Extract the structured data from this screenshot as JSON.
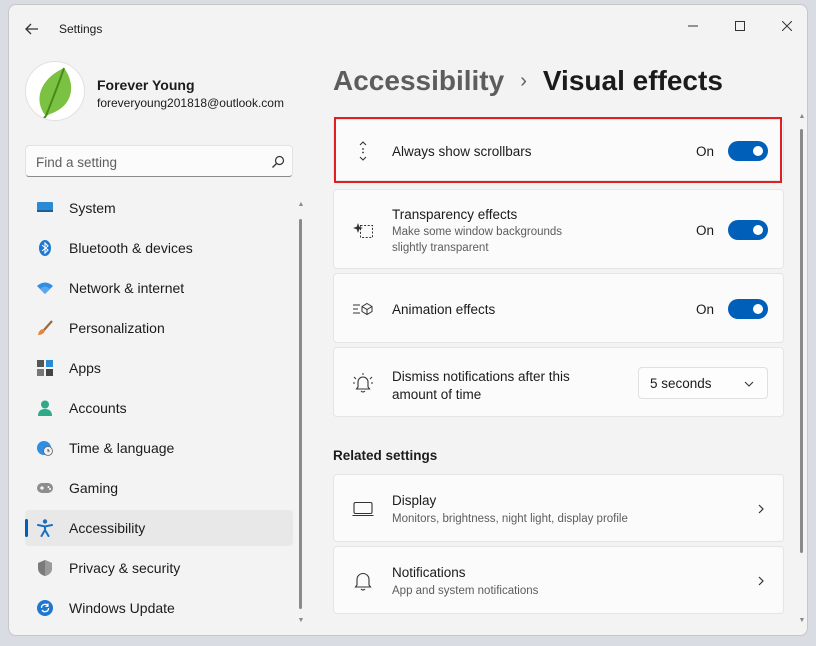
{
  "window": {
    "title": "Settings"
  },
  "profile": {
    "name": "Forever Young",
    "email": "foreveryoung201818@outlook.com"
  },
  "search": {
    "placeholder": "Find a setting",
    "value": ""
  },
  "sidebar": {
    "selected": "Accessibility",
    "items": [
      {
        "label": "System",
        "icon": "system-icon"
      },
      {
        "label": "Bluetooth & devices",
        "icon": "bluetooth-icon"
      },
      {
        "label": "Network & internet",
        "icon": "wifi-icon"
      },
      {
        "label": "Personalization",
        "icon": "brush-icon"
      },
      {
        "label": "Apps",
        "icon": "apps-icon"
      },
      {
        "label": "Accounts",
        "icon": "accounts-icon"
      },
      {
        "label": "Time & language",
        "icon": "globe-clock-icon"
      },
      {
        "label": "Gaming",
        "icon": "gamepad-icon"
      },
      {
        "label": "Accessibility",
        "icon": "accessibility-icon"
      },
      {
        "label": "Privacy & security",
        "icon": "shield-icon"
      },
      {
        "label": "Windows Update",
        "icon": "update-icon"
      }
    ]
  },
  "breadcrumb": {
    "parent": "Accessibility",
    "separator": "›",
    "current": "Visual effects"
  },
  "settings": [
    {
      "title": "Always show scrollbars",
      "description": "",
      "state": "On",
      "on": true,
      "icon": "scrollbar-icon"
    },
    {
      "title": "Transparency effects",
      "description": "Make some window backgrounds slightly transparent",
      "state": "On",
      "on": true,
      "icon": "transparency-icon"
    },
    {
      "title": "Animation effects",
      "description": "",
      "state": "On",
      "on": true,
      "icon": "animation-icon"
    },
    {
      "title": "Dismiss notifications after this amount of time",
      "dropdown_value": "5 seconds",
      "icon": "notification-timer-icon"
    }
  ],
  "related": {
    "title": "Related settings",
    "items": [
      {
        "title": "Display",
        "description": "Monitors, brightness, night light, display profile",
        "icon": "display-icon"
      },
      {
        "title": "Notifications",
        "description": "App and system notifications",
        "icon": "bell-icon"
      }
    ]
  },
  "colors": {
    "accent": "#005fb8",
    "highlight_border": "#e02020",
    "background": "#f3f3f3",
    "card": "#fbfbfb"
  }
}
